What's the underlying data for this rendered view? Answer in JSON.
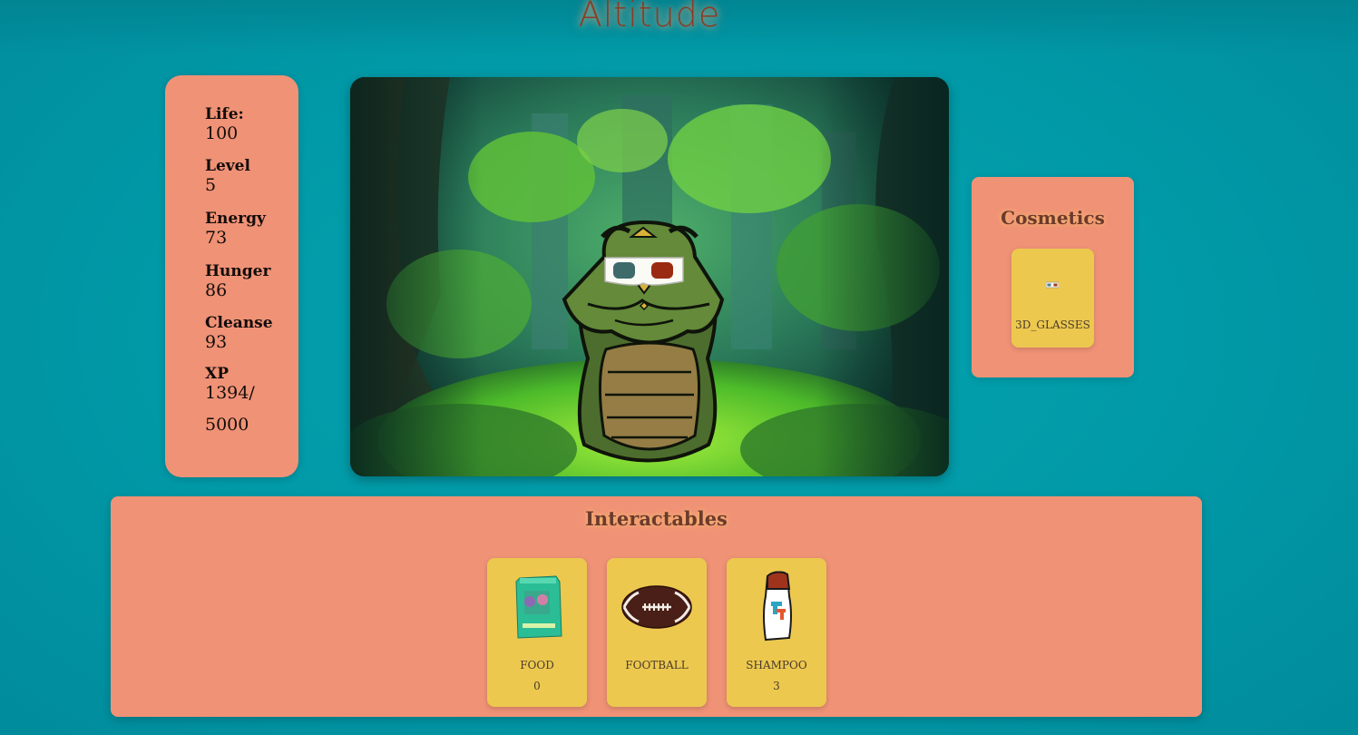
{
  "app": {
    "title": "Altitude"
  },
  "stats": [
    {
      "label": "Life:",
      "value": "100"
    },
    {
      "label": "Level",
      "value": "5"
    },
    {
      "label": "Energy",
      "value": "73"
    },
    {
      "label": "Hunger",
      "value": "86"
    },
    {
      "label": "Cleanse",
      "value": "93"
    },
    {
      "label": "XP",
      "value": "1394/"
    }
  ],
  "xp_max": "5000",
  "pet": {
    "equipped": "3d-glasses"
  },
  "cosmetics": {
    "heading": "Cosmetics",
    "items": [
      {
        "name": "3D_GLASSES",
        "icon": "3d-glasses-icon"
      }
    ]
  },
  "interactables": {
    "heading": "Interactables",
    "items": [
      {
        "name": "FOOD",
        "count": "0",
        "icon": "food-bag-icon"
      },
      {
        "name": "FOOTBALL",
        "count": "",
        "icon": "football-icon"
      },
      {
        "name": "SHAMPOO",
        "count": "3",
        "icon": "shampoo-bottle-icon"
      }
    ]
  },
  "colors": {
    "background": "#0199a7",
    "panel": "#f09276",
    "card": "#ecc84f",
    "title": "#8a3c24"
  }
}
